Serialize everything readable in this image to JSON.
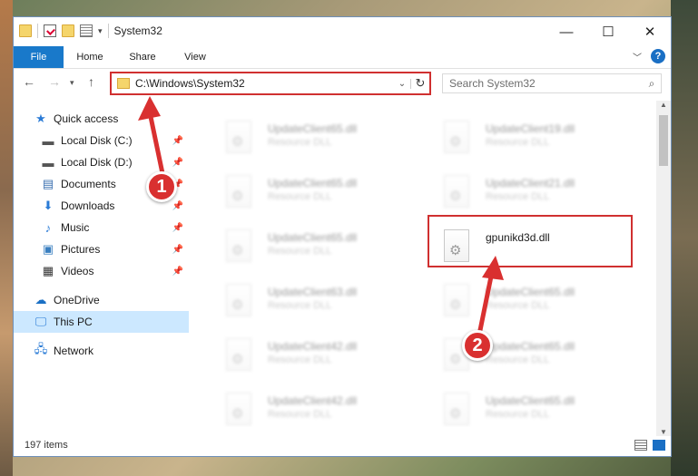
{
  "window": {
    "title": "System32",
    "controls": {
      "minimize": "—",
      "maximize": "☐",
      "close": "✕"
    }
  },
  "ribbon": {
    "tabs": [
      "File",
      "Home",
      "Share",
      "View"
    ]
  },
  "address": {
    "path": "C:\\Windows\\System32",
    "search_placeholder": "Search System32"
  },
  "nav": {
    "quick_access": "Quick access",
    "items": [
      {
        "label": "Local Disk (C:)",
        "icon": "drive-icon",
        "pinned": true
      },
      {
        "label": "Local Disk (D:)",
        "icon": "drive-icon",
        "pinned": true
      },
      {
        "label": "Documents",
        "icon": "documents-icon",
        "pinned": true
      },
      {
        "label": "Downloads",
        "icon": "downloads-icon",
        "pinned": true
      },
      {
        "label": "Music",
        "icon": "music-icon",
        "pinned": true
      },
      {
        "label": "Pictures",
        "icon": "pictures-icon",
        "pinned": true
      },
      {
        "label": "Videos",
        "icon": "videos-icon",
        "pinned": true
      }
    ],
    "onedrive": "OneDrive",
    "this_pc": "This PC",
    "network": "Network"
  },
  "files": {
    "left_column": [
      {
        "name": "UpdateClient65.dll",
        "type": "Resource DLL"
      },
      {
        "name": "UpdateClient65.dll",
        "type": "Resource DLL"
      },
      {
        "name": "UpdateClient65.dll",
        "type": "Resource DLL"
      },
      {
        "name": "UpdateClient63.dll",
        "type": "Resource DLL"
      },
      {
        "name": "UpdateClient42.dll",
        "type": "Resource DLL"
      },
      {
        "name": "UpdateClient42.dll",
        "type": "Resource DLL"
      }
    ],
    "right_column": [
      {
        "name": "UpdateClient19.dll",
        "type": "Resource DLL"
      },
      {
        "name": "UpdateClient21.dll",
        "type": "Resource DLL"
      },
      {
        "name": "gpunikd3d.dll",
        "type": ""
      },
      {
        "name": "UpdateClient65.dll",
        "type": "Resource DLL"
      },
      {
        "name": "UpdateClient65.dll",
        "type": "Resource DLL"
      },
      {
        "name": "UpdateClient65.dll",
        "type": "Resource DLL"
      }
    ],
    "highlighted": "gpunikd3d.dll"
  },
  "status": {
    "item_count": "197 items"
  },
  "annotations": {
    "badge1": "1",
    "badge2": "2",
    "color": "#d93030"
  }
}
